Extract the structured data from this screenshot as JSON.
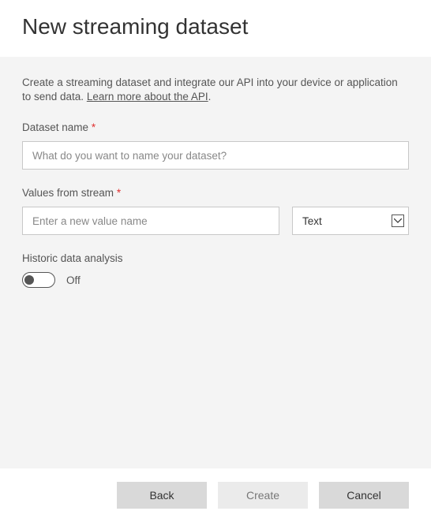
{
  "title": "New streaming dataset",
  "intro": {
    "text_before": "Create a streaming dataset and integrate our API into your device or application to send data. ",
    "link_text": "Learn more about the API",
    "text_after": "."
  },
  "fields": {
    "dataset_name": {
      "label": "Dataset name",
      "required": "*",
      "placeholder": "What do you want to name your dataset?"
    },
    "values_from_stream": {
      "label": "Values from stream",
      "required": "*",
      "placeholder": "Enter a new value name",
      "type_selected": "Text"
    },
    "historic": {
      "label": "Historic data analysis",
      "state_label": "Off"
    }
  },
  "buttons": {
    "back": "Back",
    "create": "Create",
    "cancel": "Cancel"
  }
}
